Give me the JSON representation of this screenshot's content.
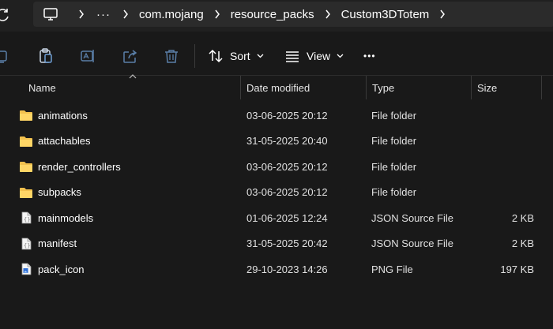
{
  "address_bar": {
    "overflow": "···",
    "crumbs": [
      "com.mojang",
      "resource_packs",
      "Custom3DTotem"
    ]
  },
  "toolbar": {
    "sort_label": "Sort",
    "view_label": "View",
    "more_label": "•••"
  },
  "columns": {
    "name": "Name",
    "date": "Date modified",
    "type": "Type",
    "size": "Size"
  },
  "files": [
    {
      "name": "animations",
      "date": "03-06-2025 20:12",
      "type": "File folder",
      "size": "",
      "icon": "folder-icon"
    },
    {
      "name": "attachables",
      "date": "31-05-2025 20:40",
      "type": "File folder",
      "size": "",
      "icon": "folder-icon"
    },
    {
      "name": "render_controllers",
      "date": "03-06-2025 20:12",
      "type": "File folder",
      "size": "",
      "icon": "folder-icon"
    },
    {
      "name": "subpacks",
      "date": "03-06-2025 20:12",
      "type": "File folder",
      "size": "",
      "icon": "folder-icon"
    },
    {
      "name": "mainmodels",
      "date": "01-06-2025 12:24",
      "type": "JSON Source File",
      "size": "2 KB",
      "icon": "json-file-icon"
    },
    {
      "name": "manifest",
      "date": "31-05-2025 20:42",
      "type": "JSON Source File",
      "size": "2 KB",
      "icon": "json-file-icon"
    },
    {
      "name": "pack_icon",
      "date": "29-10-2023 14:26",
      "type": "PNG File",
      "size": "197 KB",
      "icon": "png-file-icon"
    }
  ],
  "colors": {
    "background": "#191919",
    "address_bg": "#2b2b2b",
    "folder": "#f2c14e"
  }
}
